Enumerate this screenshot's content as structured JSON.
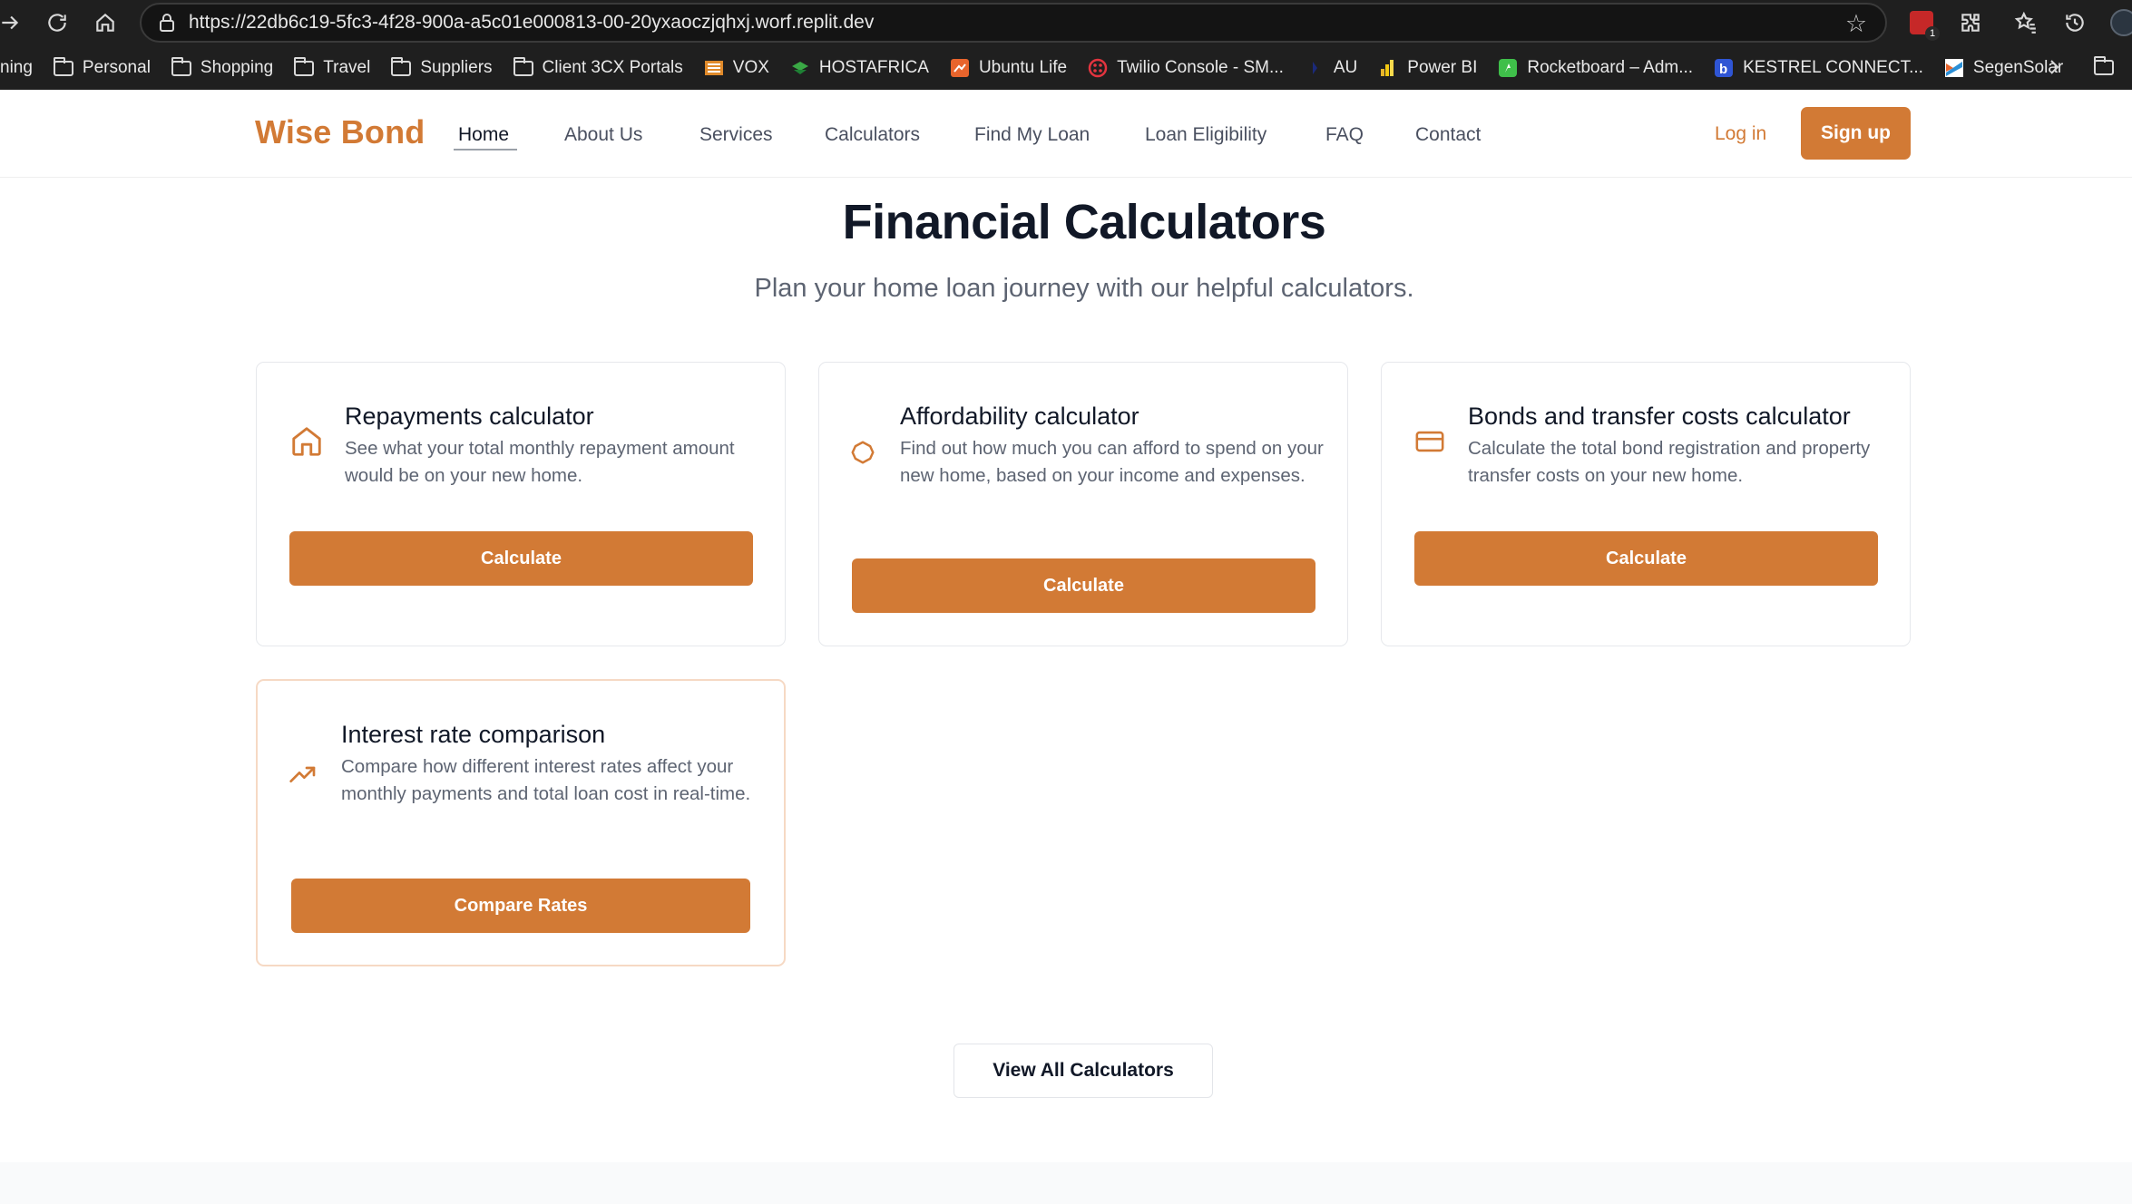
{
  "browser": {
    "url": "https://22db6c19-5fc3-4f28-900a-a5c01e000813-00-20yxaoczjqhxj.worf.replit.dev",
    "ext_badge": "1",
    "bookmarks": [
      {
        "label": "ning",
        "icon": "none"
      },
      {
        "label": "Personal",
        "icon": "folder-icon"
      },
      {
        "label": "Shopping",
        "icon": "folder-icon"
      },
      {
        "label": "Travel",
        "icon": "folder-icon"
      },
      {
        "label": "Suppliers",
        "icon": "folder-icon"
      },
      {
        "label": "Client 3CX Portals",
        "icon": "folder-icon"
      },
      {
        "label": "VOX",
        "icon": "vox-icon"
      },
      {
        "label": "HOSTAFRICA",
        "icon": "hostafrica-icon"
      },
      {
        "label": "Ubuntu Life",
        "icon": "ubuntu-life-icon"
      },
      {
        "label": "Twilio Console - SM...",
        "icon": "twilio-icon"
      },
      {
        "label": "AU",
        "icon": "au-icon"
      },
      {
        "label": "Power BI",
        "icon": "powerbi-icon"
      },
      {
        "label": "Rocketboard – Adm...",
        "icon": "rocketboard-icon"
      },
      {
        "label": "KESTREL CONNECT...",
        "icon": "kestrel-icon"
      },
      {
        "label": "SegenSolar",
        "icon": "segensolar-icon"
      }
    ]
  },
  "header": {
    "logo": "Wise Bond",
    "nav": [
      "Home",
      "About Us",
      "Services",
      "Calculators",
      "Find My Loan",
      "Loan Eligibility",
      "FAQ",
      "Contact"
    ],
    "active_nav": "Home",
    "login": "Log in",
    "signup": "Sign up"
  },
  "hero": {
    "title": "Financial Calculators",
    "subtitle": "Plan your home loan journey with our helpful calculators."
  },
  "cards": [
    {
      "icon": "home-icon",
      "title": "Repayments calculator",
      "desc": "See what your total monthly repayment amount would be on your new home.",
      "button": "Calculate"
    },
    {
      "icon": "circle-icon",
      "title": "Affordability calculator",
      "desc": "Find out how much you can afford to spend on your new home, based on your income and expenses.",
      "button": "Calculate"
    },
    {
      "icon": "credit-card-icon",
      "title": "Bonds and transfer costs calculator",
      "desc": "Calculate the total bond registration and property transfer costs on your new home.",
      "button": "Calculate"
    },
    {
      "icon": "trending-up-icon",
      "title": "Interest rate comparison",
      "desc": "Compare how different interest rates affect your monthly payments and total loan cost in real-time.",
      "button": "Compare Rates"
    }
  ],
  "view_all": "View All Calculators",
  "colors": {
    "brand": "#d27a35",
    "heading": "#111827",
    "muted": "#5d6472"
  }
}
